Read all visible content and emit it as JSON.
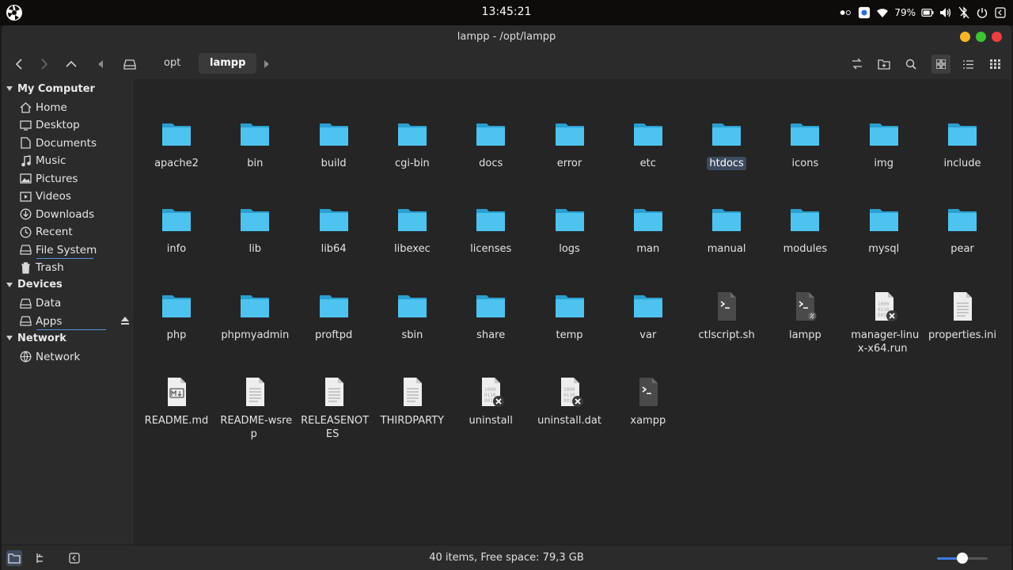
{
  "system": {
    "clock": "13:45:21",
    "battery_percent": "79%"
  },
  "window": {
    "title": "lampp - /opt/lampp"
  },
  "breadcrumb": [
    "opt",
    "lampp"
  ],
  "sidebar": {
    "sections": [
      {
        "label": "My Computer",
        "items": [
          {
            "label": "Home",
            "icon": "home-icon"
          },
          {
            "label": "Desktop",
            "icon": "desktop-icon"
          },
          {
            "label": "Documents",
            "icon": "document-icon"
          },
          {
            "label": "Music",
            "icon": "music-icon"
          },
          {
            "label": "Pictures",
            "icon": "picture-icon"
          },
          {
            "label": "Videos",
            "icon": "video-icon"
          },
          {
            "label": "Downloads",
            "icon": "download-icon"
          },
          {
            "label": "Recent",
            "icon": "recent-icon"
          },
          {
            "label": "File System",
            "icon": "drive-icon"
          },
          {
            "label": "Trash",
            "icon": "trash-icon"
          }
        ]
      },
      {
        "label": "Devices",
        "items": [
          {
            "label": "Data",
            "icon": "drive-icon"
          },
          {
            "label": "Apps",
            "icon": "drive-icon"
          }
        ]
      },
      {
        "label": "Network",
        "items": [
          {
            "label": "Network",
            "icon": "network-icon"
          }
        ]
      }
    ]
  },
  "files": [
    {
      "name": "apache2",
      "type": "folder"
    },
    {
      "name": "bin",
      "type": "folder"
    },
    {
      "name": "build",
      "type": "folder"
    },
    {
      "name": "cgi-bin",
      "type": "folder"
    },
    {
      "name": "docs",
      "type": "folder"
    },
    {
      "name": "error",
      "type": "folder"
    },
    {
      "name": "etc",
      "type": "folder"
    },
    {
      "name": "htdocs",
      "type": "folder",
      "selected": true
    },
    {
      "name": "icons",
      "type": "folder"
    },
    {
      "name": "img",
      "type": "folder"
    },
    {
      "name": "include",
      "type": "folder"
    },
    {
      "name": "info",
      "type": "folder"
    },
    {
      "name": "lib",
      "type": "folder"
    },
    {
      "name": "lib64",
      "type": "folder"
    },
    {
      "name": "libexec",
      "type": "folder"
    },
    {
      "name": "licenses",
      "type": "folder"
    },
    {
      "name": "logs",
      "type": "folder"
    },
    {
      "name": "man",
      "type": "folder"
    },
    {
      "name": "manual",
      "type": "folder"
    },
    {
      "name": "modules",
      "type": "folder"
    },
    {
      "name": "mysql",
      "type": "folder"
    },
    {
      "name": "pear",
      "type": "folder"
    },
    {
      "name": "php",
      "type": "folder"
    },
    {
      "name": "phpmyadmin",
      "type": "folder"
    },
    {
      "name": "proftpd",
      "type": "folder"
    },
    {
      "name": "sbin",
      "type": "folder"
    },
    {
      "name": "share",
      "type": "folder"
    },
    {
      "name": "temp",
      "type": "folder"
    },
    {
      "name": "var",
      "type": "folder"
    },
    {
      "name": "ctlscript.sh",
      "type": "script"
    },
    {
      "name": "lampp",
      "type": "script-link"
    },
    {
      "name": "manager-linux-x64.run",
      "type": "binary"
    },
    {
      "name": "properties.ini",
      "type": "text"
    },
    {
      "name": "README.md",
      "type": "markdown"
    },
    {
      "name": "README-wsrep",
      "type": "text"
    },
    {
      "name": "RELEASENOTES",
      "type": "text"
    },
    {
      "name": "THIRDPARTY",
      "type": "text"
    },
    {
      "name": "uninstall",
      "type": "binary"
    },
    {
      "name": "uninstall.dat",
      "type": "binary"
    },
    {
      "name": "xampp",
      "type": "script"
    }
  ],
  "statusbar": {
    "text": "40 items, Free space: 79,3 GB",
    "zoom_fraction": 0.5
  },
  "colors": {
    "folder": "#4fc3ef",
    "selection": "#3e4a5e",
    "accent": "#3d7be0"
  }
}
